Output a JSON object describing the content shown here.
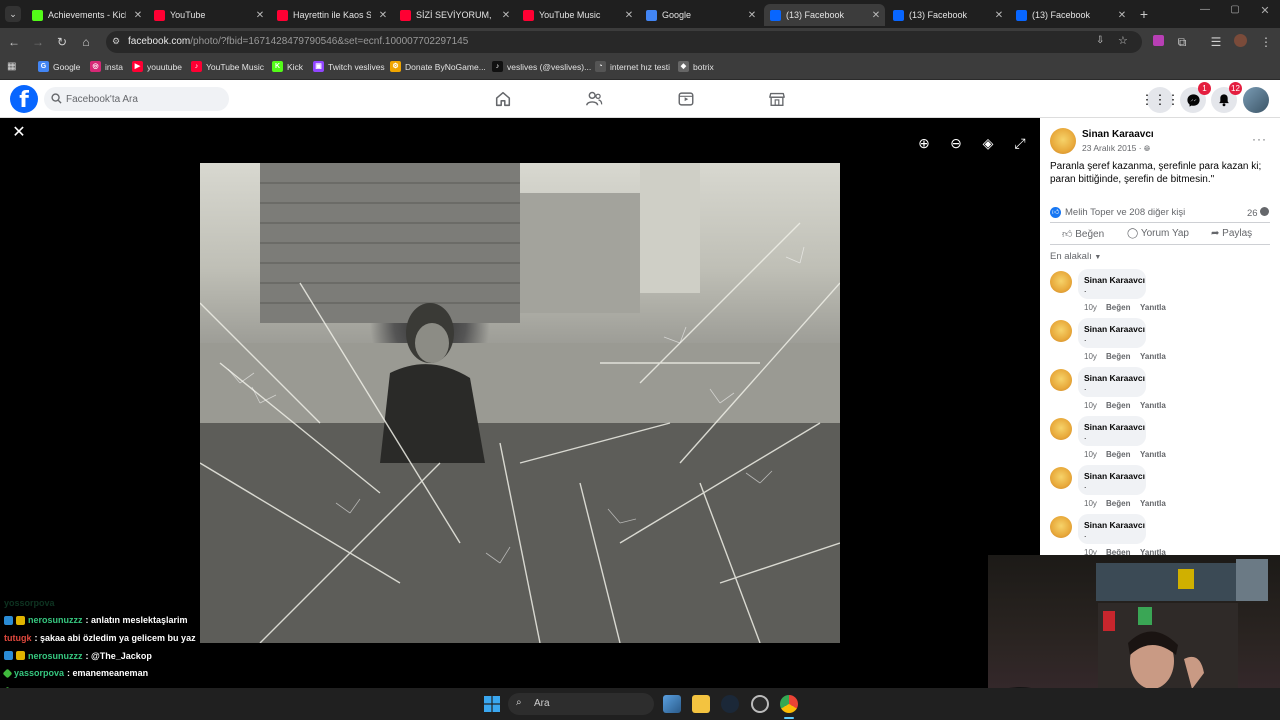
{
  "browser": {
    "tabs": [
      {
        "title": "Achievements - Kick",
        "favicon": "kick-icon",
        "color": "#53fc18",
        "active": false
      },
      {
        "title": "YouTube",
        "favicon": "youtube-icon",
        "color": "#ff0033",
        "active": false
      },
      {
        "title": "Hayrettin ile Kaos Sh",
        "favicon": "youtube-icon",
        "color": "#ff0033",
        "active": false
      },
      {
        "title": "SİZİ SEVİYORUM, SİZ",
        "favicon": "youtube-icon",
        "color": "#ff0033",
        "active": false
      },
      {
        "title": "YouTube Music",
        "favicon": "youtube-music-icon",
        "color": "#ff0033",
        "active": false
      },
      {
        "title": "Google",
        "favicon": "google-icon",
        "color": "#4285f4",
        "active": false
      },
      {
        "title": "(13) Facebook",
        "favicon": "facebook-icon",
        "color": "#0866ff",
        "active": true
      },
      {
        "title": "(13) Facebook",
        "favicon": "facebook-icon",
        "color": "#0866ff",
        "active": false
      },
      {
        "title": "(13) Facebook",
        "favicon": "facebook-icon",
        "color": "#0866ff",
        "active": false
      }
    ],
    "url_host": "facebook.com",
    "url_path": "/photo/?fbid=1671428479790546&set=ecnf.100007702297145",
    "bookmarks": [
      {
        "label": "Google",
        "color": "#4285f4",
        "glyph": "G"
      },
      {
        "label": "insta",
        "color": "#d62976",
        "glyph": "◎"
      },
      {
        "label": "youutube",
        "color": "#ff0033",
        "glyph": "▶"
      },
      {
        "label": "YouTube Music",
        "color": "#ff0033",
        "glyph": "♪"
      },
      {
        "label": "Kick",
        "color": "#53fc18",
        "glyph": "K"
      },
      {
        "label": "Twitch veslives",
        "color": "#9146ff",
        "glyph": "▣"
      },
      {
        "label": "Donate ByNoGame...",
        "color": "#f0a500",
        "glyph": "⚙"
      },
      {
        "label": "veslives (@veslives)...",
        "color": "#111111",
        "glyph": "♪"
      },
      {
        "label": "internet hız testi",
        "color": "#555555",
        "glyph": "◔"
      },
      {
        "label": "botrix",
        "color": "#666666",
        "glyph": "◆"
      }
    ]
  },
  "facebook": {
    "search_placeholder": "Facebook'ta Ara",
    "messenger_badge": "1",
    "notifications_badge": "12",
    "post": {
      "author": "Sinan Karaavcı",
      "date": "23 Aralık 2015 · ",
      "caption": "Paranla şeref kazanma, şerefinle para kazan ki; paran bittiğinde, şerefin de bitmesin.\"",
      "reactions_text": "Melih Toper ve 208 diğer kişi",
      "comments_count": "26",
      "actions": {
        "like": "Beğen",
        "comment": "Yorum Yap",
        "share": "Paylaş"
      },
      "sort_label": "En alakalı",
      "comments": [
        {
          "author": "Sinan Karaavcı",
          "text": ".",
          "age": "10y",
          "like": "Beğen",
          "reply": "Yanıtla"
        },
        {
          "author": "Sinan Karaavcı",
          "text": ".",
          "age": "10y",
          "like": "Beğen",
          "reply": "Yanıtla"
        },
        {
          "author": "Sinan Karaavcı",
          "text": ".",
          "age": "10y",
          "like": "Beğen",
          "reply": "Yanıtla"
        },
        {
          "author": "Sinan Karaavcı",
          "text": ".",
          "age": "10y",
          "like": "Beğen",
          "reply": "Yanıtla"
        },
        {
          "author": "Sinan Karaavcı",
          "text": ".",
          "age": "10y",
          "like": "Beğen",
          "reply": "Yanıtla"
        },
        {
          "author": "Sinan Karaavcı",
          "text": ".",
          "age": "10y",
          "like": "Beğen",
          "reply": "Yanıtla"
        }
      ]
    }
  },
  "stream_chat": [
    {
      "user": "nerosunuzzz",
      "message": ": anlatın meslektaşlarim",
      "user_color": "#36c77f",
      "badge": "mod"
    },
    {
      "user": "tutugk",
      "message": ": şakaa abi özledim ya gelicem bu yaz",
      "user_color": "#e0483d",
      "badge": "none"
    },
    {
      "user": "nerosunuzzz",
      "message": ": @The_Jackop",
      "user_color": "#36c77f",
      "badge": "mod"
    },
    {
      "user": "yassorpova",
      "message": ": emanemeaneman",
      "user_color": "#36c77f",
      "badge": "kick"
    },
    {
      "user": "yassorpova",
      "message": ": emanemeaneman",
      "user_color": "#36c77f",
      "badge": "kick"
    },
    {
      "user": "yassorpova",
      "message": ":",
      "user_color": "#36c77f",
      "badge": "kick"
    }
  ],
  "taskbar": {
    "search_placeholder": "Ara"
  }
}
